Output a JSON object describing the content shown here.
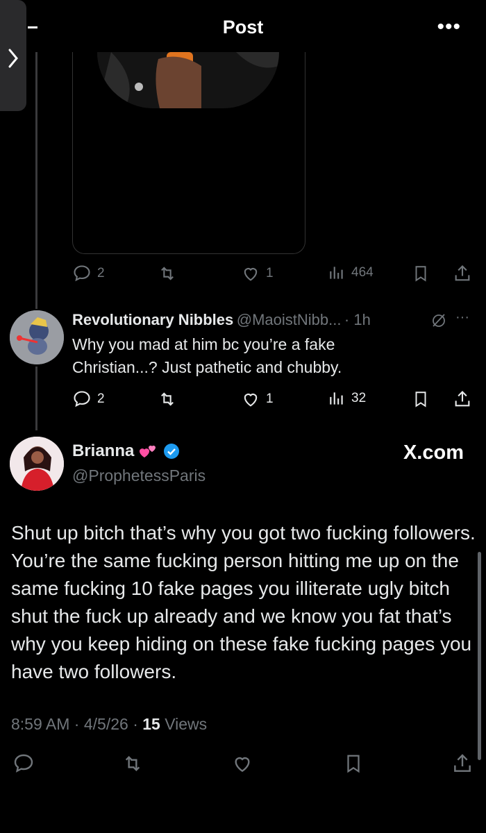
{
  "header": {
    "title": "Post",
    "more_icon": "more-horizontal-icon"
  },
  "parent_post_actions": {
    "replies": "2",
    "likes": "1",
    "views": "464"
  },
  "reply": {
    "display_name": "Revolutionary Nibbles",
    "handle": "@MaoistNibb...",
    "time": "· 1h",
    "text_line1": "Why you mad at him bc you’re a fake",
    "text_line2": "Christian...? Just pathetic and chubby.",
    "replies": "2",
    "likes": "1",
    "views": "32"
  },
  "main_post": {
    "display_name": "Brianna",
    "handle": "@ProphetessParis",
    "watermark": "X.com",
    "text": "Shut up bitch that’s why you got two fucking followers. You’re the same fucking person hitting me up on the same fucking 10 fake pages you illiterate ugly bitch shut the fuck up already and we know you fat that’s why you keep hiding on these fake fucking pages you have two followers.",
    "time": "8:59 AM",
    "date": "4/5/26",
    "views_count": "15",
    "views_label": "Views"
  },
  "colors": {
    "background": "#000000",
    "text": "#e7e9ea",
    "muted": "#71767b",
    "verified": "#1d9bf0",
    "heart_emoji": "#ff4fa3"
  }
}
